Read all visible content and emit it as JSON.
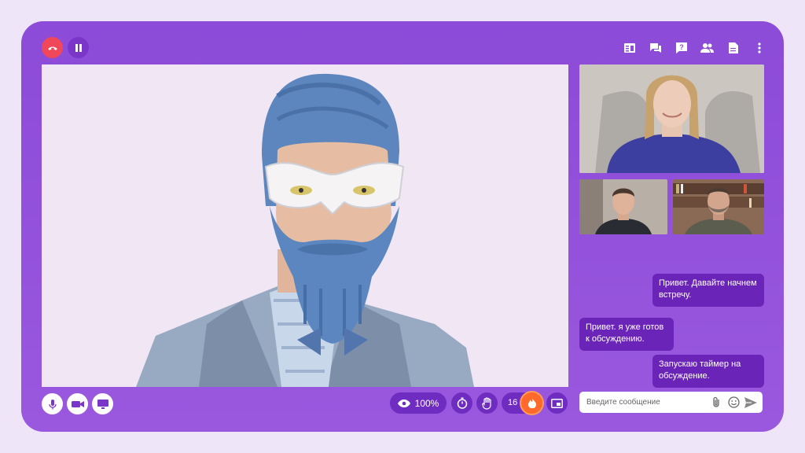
{
  "controls": {
    "view_percent": "100%",
    "participants_count": "16"
  },
  "chat": {
    "messages": [
      {
        "text": "Привет. Давайте начнем встречу.",
        "side": "right"
      },
      {
        "text": "Привет. я уже готов к обсуждению.",
        "side": "left"
      },
      {
        "text": "Запускаю таймер на обсуждение.",
        "side": "right"
      }
    ],
    "input_placeholder": "Введите сообщение"
  },
  "icons": {
    "top_left": [
      "hang-up-icon",
      "pause-icon"
    ],
    "top_right": [
      "notes-icon",
      "chat-icon",
      "help-icon",
      "participants-icon",
      "document-icon",
      "more-icon"
    ],
    "bottom_left": [
      "microphone-icon",
      "camera-icon",
      "screen-share-icon"
    ],
    "bottom_center": [
      "eye-icon",
      "timer-icon",
      "raise-hand-icon",
      "fire-icon",
      "picture-in-picture-icon"
    ],
    "chat_input": [
      "attach-icon",
      "emoji-icon",
      "send-icon"
    ]
  },
  "colors": {
    "page_background": "#efe5f8",
    "frame": "#8c4bd8",
    "hang_up": "#f0475a",
    "dark_button": "#6f2cc0",
    "chat_bubble": "#6a25b8",
    "fire": "#ff6a2a"
  }
}
